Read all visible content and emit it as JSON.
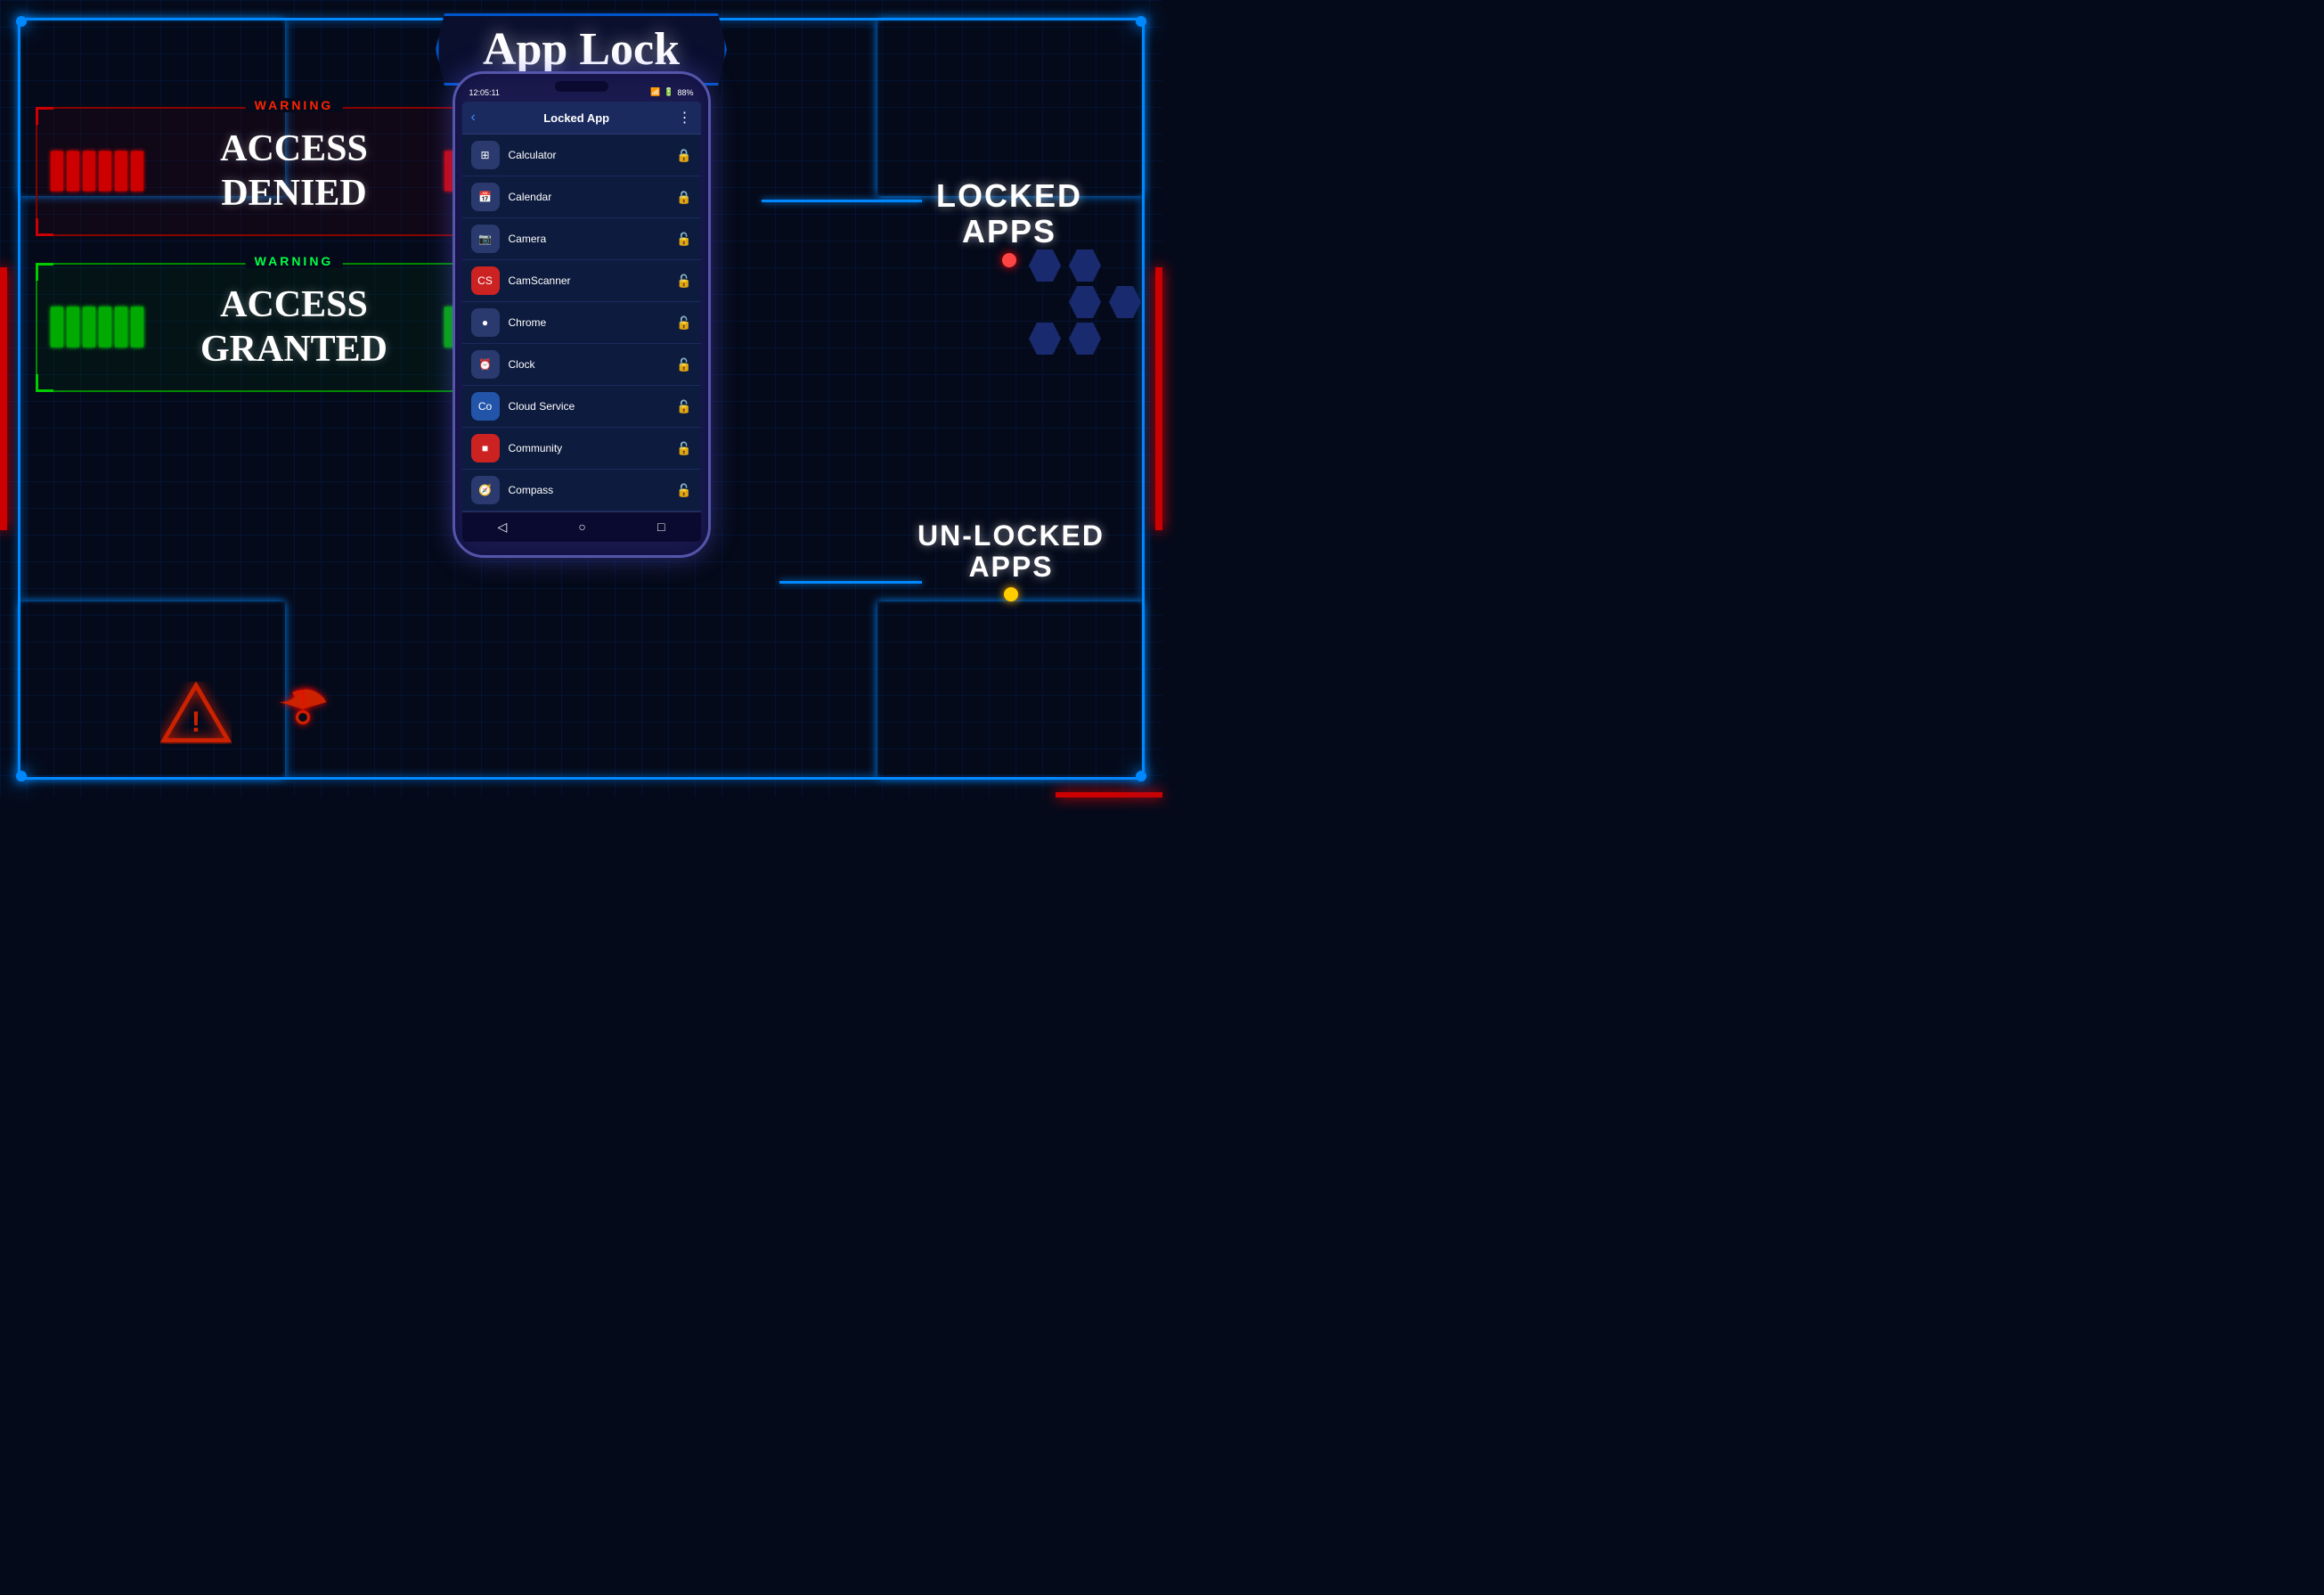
{
  "page": {
    "title": "App Lock",
    "warning_label": "WARNING"
  },
  "access_denied": {
    "warning": "WARNING",
    "line1": "ACCESS",
    "line2": "DENIED"
  },
  "access_granted": {
    "warning": "WARNING",
    "line1": "ACCESS",
    "line2": "GRANTED"
  },
  "labels": {
    "locked_apps": "LOCKED\nAPPS",
    "locked_line1": "LOCKED",
    "locked_line2": "APPS",
    "unlocked_line1": "UN-LOCKED",
    "unlocked_line2": "APPS"
  },
  "phone": {
    "status_time": "12:05:11",
    "battery": "88%",
    "header_title": "Locked App",
    "back_icon": "‹",
    "menu_icon": "⋮",
    "nav_back": "◁",
    "nav_home": "○",
    "nav_recent": "□"
  },
  "apps": [
    {
      "name": "Calculator",
      "icon": "⊞",
      "locked": true,
      "icon_bg": "#2a3a6e"
    },
    {
      "name": "Calendar",
      "icon": "📅",
      "locked": true,
      "icon_bg": "#2a3a6e"
    },
    {
      "name": "Camera",
      "icon": "📷",
      "locked": false,
      "icon_bg": "#2a3a6e"
    },
    {
      "name": "CamScanner",
      "icon": "CS",
      "locked": false,
      "icon_bg": "#cc2222"
    },
    {
      "name": "Chrome",
      "icon": "◎",
      "locked": false,
      "icon_bg": "#2a3a6e"
    },
    {
      "name": "Clock",
      "icon": "⏰",
      "locked": false,
      "icon_bg": "#2a3a6e"
    },
    {
      "name": "Cloud Service",
      "icon": "Co",
      "locked": false,
      "icon_bg": "#2255aa"
    },
    {
      "name": "Community",
      "icon": "■",
      "locked": false,
      "icon_bg": "#cc2222"
    },
    {
      "name": "Compass",
      "icon": "🧭",
      "locked": false,
      "icon_bg": "#2a3a6e"
    }
  ]
}
